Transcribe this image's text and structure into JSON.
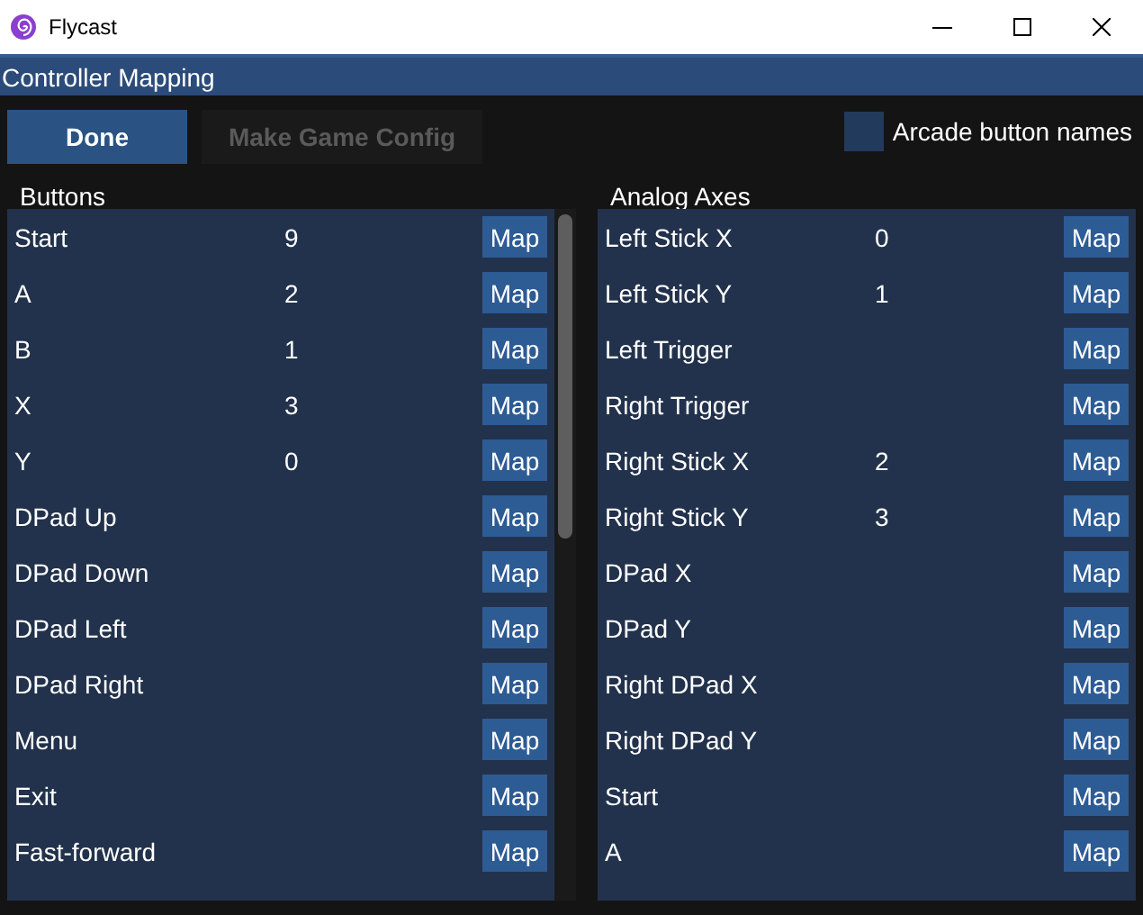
{
  "window": {
    "title": "Flycast"
  },
  "header": {
    "title": "Controller Mapping"
  },
  "toolbar": {
    "done": "Done",
    "make_game_config": {
      "label": "Make Game Config",
      "disabled": true
    },
    "arcade_button_names": {
      "label": "Arcade button names",
      "checked": false
    }
  },
  "buttons": {
    "heading": "Buttons",
    "rows": [
      {
        "name": "Start",
        "value": "9",
        "action": "Map"
      },
      {
        "name": "A",
        "value": "2",
        "action": "Map"
      },
      {
        "name": "B",
        "value": "1",
        "action": "Map"
      },
      {
        "name": "X",
        "value": "3",
        "action": "Map"
      },
      {
        "name": "Y",
        "value": "0",
        "action": "Map"
      },
      {
        "name": "DPad Up",
        "action": "Map"
      },
      {
        "name": "DPad Down",
        "action": "Map"
      },
      {
        "name": "DPad Left",
        "action": "Map"
      },
      {
        "name": "DPad Right",
        "action": "Map"
      },
      {
        "name": "Menu",
        "action": "Map"
      },
      {
        "name": "Exit",
        "action": "Map"
      },
      {
        "name": "Fast-forward",
        "action": "Map"
      }
    ]
  },
  "analog_axes": {
    "heading": "Analog Axes",
    "rows": [
      {
        "name": "Left Stick X",
        "value": "0",
        "action": "Map"
      },
      {
        "name": "Left Stick Y",
        "value": "1",
        "action": "Map"
      },
      {
        "name": "Left Trigger",
        "action": "Map"
      },
      {
        "name": "Right Trigger",
        "action": "Map"
      },
      {
        "name": "Right Stick X",
        "value": "2",
        "action": "Map"
      },
      {
        "name": "Right Stick Y",
        "value": "3",
        "action": "Map"
      },
      {
        "name": "DPad X",
        "action": "Map"
      },
      {
        "name": "DPad Y",
        "action": "Map"
      },
      {
        "name": "Right DPad X",
        "action": "Map"
      },
      {
        "name": "Right DPad Y",
        "action": "Map"
      },
      {
        "name": "Start",
        "action": "Map"
      },
      {
        "name": "A",
        "action": "Map"
      }
    ]
  }
}
